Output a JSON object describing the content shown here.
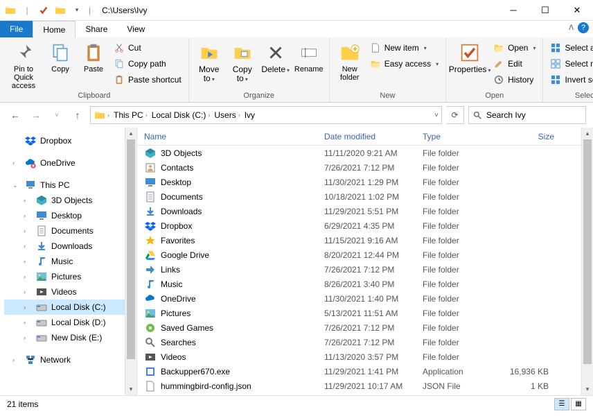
{
  "title_path": "C:\\Users\\Ivy",
  "tabs": {
    "file": "File",
    "home": "Home",
    "share": "Share",
    "view": "View"
  },
  "ribbon": {
    "pin": "Pin to Quick access",
    "copy": "Copy",
    "paste": "Paste",
    "cut": "Cut",
    "copypath": "Copy path",
    "pasteshort": "Paste shortcut",
    "moveto": "Move to",
    "copyto": "Copy to",
    "delete": "Delete",
    "rename": "Rename",
    "newfolder": "New folder",
    "newitem": "New item",
    "easyaccess": "Easy access",
    "properties": "Properties",
    "open": "Open",
    "edit": "Edit",
    "history": "History",
    "selectall": "Select all",
    "selectnone": "Select none",
    "invert": "Invert selection",
    "g_clipboard": "Clipboard",
    "g_organize": "Organize",
    "g_new": "New",
    "g_open": "Open",
    "g_select": "Select"
  },
  "breadcrumbs": [
    "This PC",
    "Local Disk (C:)",
    "Users",
    "Ivy"
  ],
  "search_placeholder": "Search Ivy",
  "nav": {
    "dropbox": "Dropbox",
    "onedrive": "OneDrive",
    "thispc": "This PC",
    "threed": "3D Objects",
    "desktop": "Desktop",
    "documents": "Documents",
    "downloads": "Downloads",
    "music": "Music",
    "pictures": "Pictures",
    "videos": "Videos",
    "diskc": "Local Disk (C:)",
    "diskd": "Local Disk (D:)",
    "diske": "New Disk (E:)",
    "network": "Network"
  },
  "columns": {
    "name": "Name",
    "date": "Date modified",
    "type": "Type",
    "size": "Size"
  },
  "files": [
    {
      "ic": "cube",
      "name": "3D Objects",
      "date": "11/11/2020 9:21 AM",
      "type": "File folder",
      "size": ""
    },
    {
      "ic": "contacts",
      "name": "Contacts",
      "date": "7/26/2021 7:12 PM",
      "type": "File folder",
      "size": ""
    },
    {
      "ic": "desktop",
      "name": "Desktop",
      "date": "11/30/2021 1:29 PM",
      "type": "File folder",
      "size": ""
    },
    {
      "ic": "doc",
      "name": "Documents",
      "date": "10/18/2021 1:02 PM",
      "type": "File folder",
      "size": ""
    },
    {
      "ic": "down",
      "name": "Downloads",
      "date": "11/29/2021 5:51 PM",
      "type": "File folder",
      "size": ""
    },
    {
      "ic": "dropbox",
      "name": "Dropbox",
      "date": "6/29/2021 4:35 PM",
      "type": "File folder",
      "size": ""
    },
    {
      "ic": "star",
      "name": "Favorites",
      "date": "11/15/2021 9:16 AM",
      "type": "File folder",
      "size": ""
    },
    {
      "ic": "gdrive",
      "name": "Google Drive",
      "date": "8/20/2021 12:44 PM",
      "type": "File folder",
      "size": ""
    },
    {
      "ic": "link",
      "name": "Links",
      "date": "7/26/2021 7:12 PM",
      "type": "File folder",
      "size": ""
    },
    {
      "ic": "music",
      "name": "Music",
      "date": "8/26/2021 3:40 PM",
      "type": "File folder",
      "size": ""
    },
    {
      "ic": "onedrive",
      "name": "OneDrive",
      "date": "11/30/2021 1:40 PM",
      "type": "File folder",
      "size": ""
    },
    {
      "ic": "pic",
      "name": "Pictures",
      "date": "5/13/2021 11:51 AM",
      "type": "File folder",
      "size": ""
    },
    {
      "ic": "games",
      "name": "Saved Games",
      "date": "7/26/2021 7:12 PM",
      "type": "File folder",
      "size": ""
    },
    {
      "ic": "search",
      "name": "Searches",
      "date": "7/26/2021 7:12 PM",
      "type": "File folder",
      "size": ""
    },
    {
      "ic": "video",
      "name": "Videos",
      "date": "11/13/2020 3:57 PM",
      "type": "File folder",
      "size": ""
    },
    {
      "ic": "exe",
      "name": "Backupper670.exe",
      "date": "11/29/2021 1:41 PM",
      "type": "Application",
      "size": "16,936 KB"
    },
    {
      "ic": "file",
      "name": "hummingbird-config.json",
      "date": "11/29/2021 10:17 AM",
      "type": "JSON File",
      "size": "1 KB"
    }
  ],
  "status": "21 items"
}
